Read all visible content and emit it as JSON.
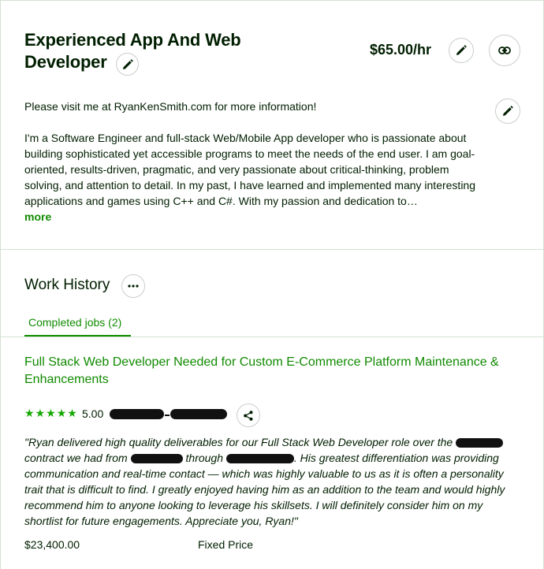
{
  "profile": {
    "title": "Experienced App And Web Developer",
    "rate": "$65.00/hr"
  },
  "overview": {
    "intro": "Please visit me at RyanKenSmith.com for more information!",
    "body": "I'm a Software Engineer and full-stack Web/Mobile App developer who is passionate about building sophisticated yet accessible programs to meet the needs of the end user. I am goal-oriented, results-driven, pragmatic, and very passionate about critical-thinking, problem solving, and attention to detail. In my past, I have learned and implemented many interesting applications and games using C++ and C#. With my passion and dedication to…",
    "more_label": "more"
  },
  "work_history": {
    "title": "Work History",
    "tabs": [
      {
        "label": "Completed jobs (2)"
      }
    ],
    "jobs": [
      {
        "title": "Full Stack Web Developer Needed for Custom E-Commerce Platform Maintenance & Enhancements",
        "rating": "5.00",
        "review_parts": [
          "\"Ryan delivered high quality deliverables for our Full Stack Web Developer role over the",
          "contract we had from",
          "through",
          ". His greatest differentiation was providing communication and real-time contact — which was highly valuable to us as it is often a personality trait that is difficult to find. I greatly enjoyed having him as an addition to the team and would highly recommend him to anyone looking to leverage his skillsets. I will definitely consider him on my shortlist for future engagements. Appreciate you, Ryan!\""
        ],
        "price": "$23,400.00",
        "price_type": "Fixed Price"
      }
    ]
  },
  "colors": {
    "accent": "#108a00",
    "star": "#14a800",
    "text": "#001e00",
    "divider": "#d5e0d5"
  },
  "icons": {
    "edit": "pencil-icon",
    "link": "link-icon",
    "more": "ellipsis-icon",
    "share": "share-icon",
    "star": "star-icon"
  }
}
